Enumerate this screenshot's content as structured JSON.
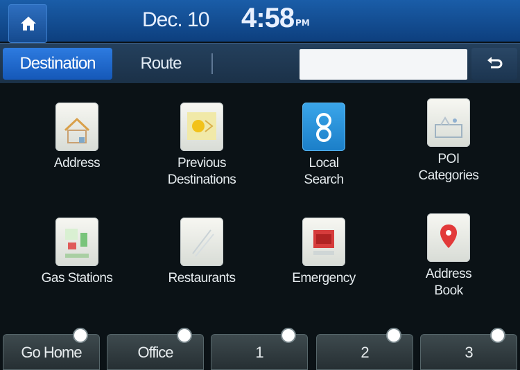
{
  "status": {
    "date": "Dec. 10",
    "time": "4:58",
    "ampm": "PM"
  },
  "tabs": [
    {
      "label": "Destination",
      "selected": true
    },
    {
      "label": "Route",
      "selected": false
    }
  ],
  "search": {
    "value": ""
  },
  "grid": [
    {
      "label": "Address",
      "icon": "address-icon"
    },
    {
      "label": "Previous\nDestinations",
      "icon": "previous-destinations-icon"
    },
    {
      "label": "Local\nSearch",
      "icon": "local-search-icon"
    },
    {
      "label": "POI\nCategories",
      "icon": "poi-categories-icon"
    },
    {
      "label": "Gas Stations",
      "icon": "gas-stations-icon"
    },
    {
      "label": "Restaurants",
      "icon": "restaurants-icon"
    },
    {
      "label": "Emergency",
      "icon": "emergency-icon"
    },
    {
      "label": "Address\nBook",
      "icon": "address-book-icon"
    }
  ],
  "shortcuts": [
    {
      "label": "Go Home"
    },
    {
      "label": "Office"
    },
    {
      "label": "1"
    },
    {
      "label": "2"
    },
    {
      "label": "3"
    }
  ],
  "colors": {
    "status_bar": "#1a5da8",
    "tab_selected": "#1f6fd0",
    "background": "#0b1216"
  }
}
